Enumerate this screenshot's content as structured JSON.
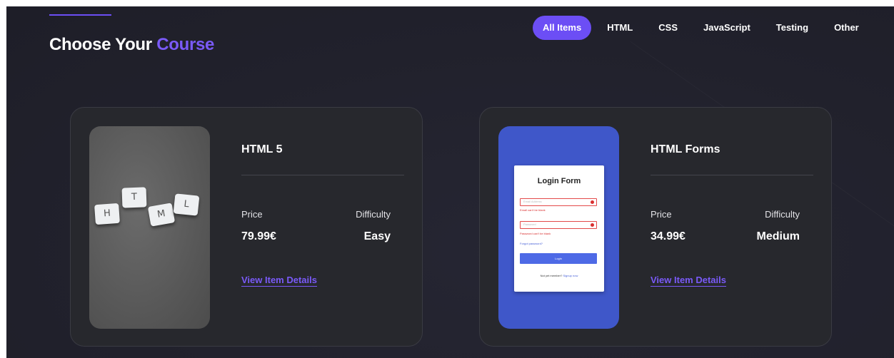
{
  "header": {
    "title_main": "Choose Your",
    "title_accent": "Course"
  },
  "filters": [
    {
      "label": "All Items",
      "active": true
    },
    {
      "label": "HTML",
      "active": false
    },
    {
      "label": "CSS",
      "active": false
    },
    {
      "label": "JavaScript",
      "active": false
    },
    {
      "label": "Testing",
      "active": false
    },
    {
      "label": "Other",
      "active": false
    }
  ],
  "courses": [
    {
      "name": "HTML 5",
      "price_label": "Price",
      "price": "79.99€",
      "difficulty_label": "Difficulty",
      "difficulty": "Easy",
      "details_link": "View Item Details",
      "tiles": [
        "H",
        "T",
        "M",
        "L"
      ]
    },
    {
      "name": "HTML Forms",
      "price_label": "Price",
      "price": "34.99€",
      "difficulty_label": "Difficulty",
      "difficulty": "Medium",
      "details_link": "View Item Details",
      "login_mockup": {
        "title": "Login Form",
        "email_placeholder": "Email Address",
        "email_error": "Email can't be blank",
        "password_placeholder": "Password",
        "password_error": "Password can't be blank",
        "forgot": "Forgot password?",
        "button": "Login",
        "footer_text": "Not yet member?",
        "footer_link": "Signup now"
      }
    }
  ],
  "colors": {
    "accent": "#6c4ef5",
    "background": "#21212c",
    "card": "#27282d",
    "error": "#d93030"
  }
}
